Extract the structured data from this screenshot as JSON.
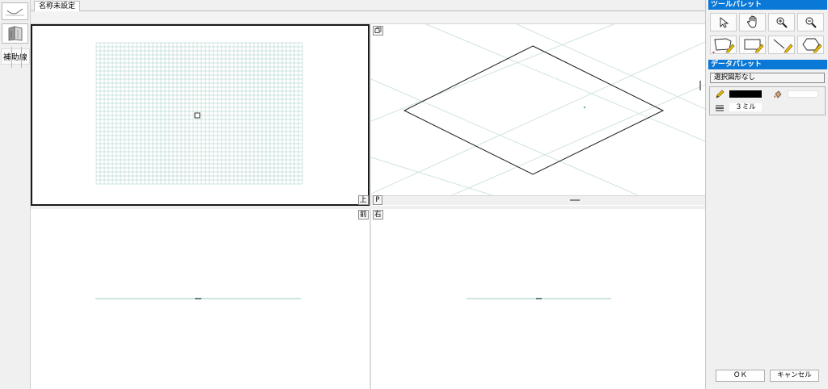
{
  "document": {
    "tab_title": "名称未設定"
  },
  "left_toolbar": {
    "aux_line_label": "補助線"
  },
  "views": {
    "top_label": "上",
    "front_label": "前",
    "right_label": "右",
    "perspective_label": "P"
  },
  "tool_palette": {
    "title": "ツールパレット",
    "tools": [
      "select-arrow-icon",
      "hand-pan-icon",
      "zoom-in-icon",
      "zoom-out-icon",
      "polygon-draw-icon",
      "rectangle-draw-icon",
      "line-draw-icon",
      "hexagon-draw-icon"
    ]
  },
  "data_palette": {
    "title": "データパレット",
    "selection_status": "選択図形なし",
    "line_color": "#000000",
    "fill_color": "#ffffff",
    "line_weight": "３ミル"
  },
  "dialog": {
    "ok_label": "ＯＫ",
    "cancel_label": "キャンセル"
  },
  "colors": {
    "palette_title_bg": "#0a78d7",
    "grid_line": "#9ec9c4",
    "guide_line": "#cfe4e0"
  }
}
